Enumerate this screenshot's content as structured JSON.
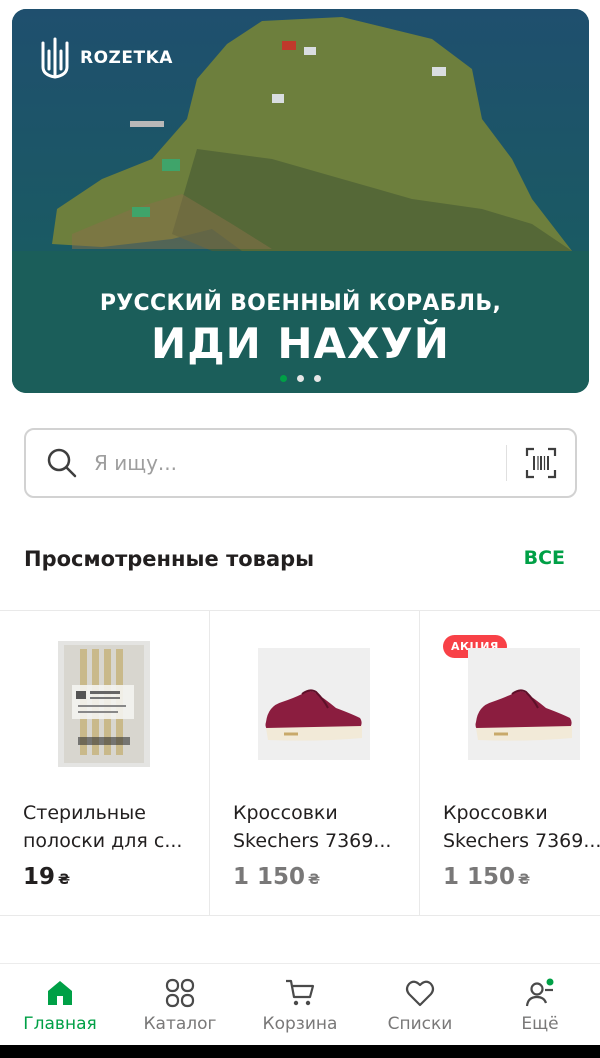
{
  "banner": {
    "brand": "ROZETKA",
    "line1": "РУССКИЙ ВОЕННЫЙ КОРАБЛЬ,",
    "line2": "ИДИ НАХУЙ",
    "slides_count": 3,
    "active_slide": 1
  },
  "search": {
    "placeholder": "Я ищу..."
  },
  "viewed": {
    "title": "Просмотренные товары",
    "all_label": "ВСЕ",
    "products": [
      {
        "title": "Стерильные полоски для с...",
        "price": "19",
        "currency": "₴",
        "badge": ""
      },
      {
        "title": "Кроссовки Skechers 7369...",
        "price": "1 150",
        "currency": "₴",
        "badge": ""
      },
      {
        "title": "Кроссовки Skechers 7369...",
        "price": "1 150",
        "currency": "₴",
        "badge": "АКЦИЯ"
      }
    ]
  },
  "tabbar": {
    "items": [
      {
        "label": "Главная",
        "icon": "home-icon",
        "active": true
      },
      {
        "label": "Каталог",
        "icon": "catalog-icon",
        "active": false
      },
      {
        "label": "Корзина",
        "icon": "cart-icon",
        "active": false
      },
      {
        "label": "Списки",
        "icon": "heart-icon",
        "active": false
      },
      {
        "label": "Ещё",
        "icon": "user-icon",
        "active": false
      }
    ]
  },
  "colors": {
    "accent": "#00a046",
    "banner_bg": "#1b5e5a",
    "badge": "#f84147"
  }
}
